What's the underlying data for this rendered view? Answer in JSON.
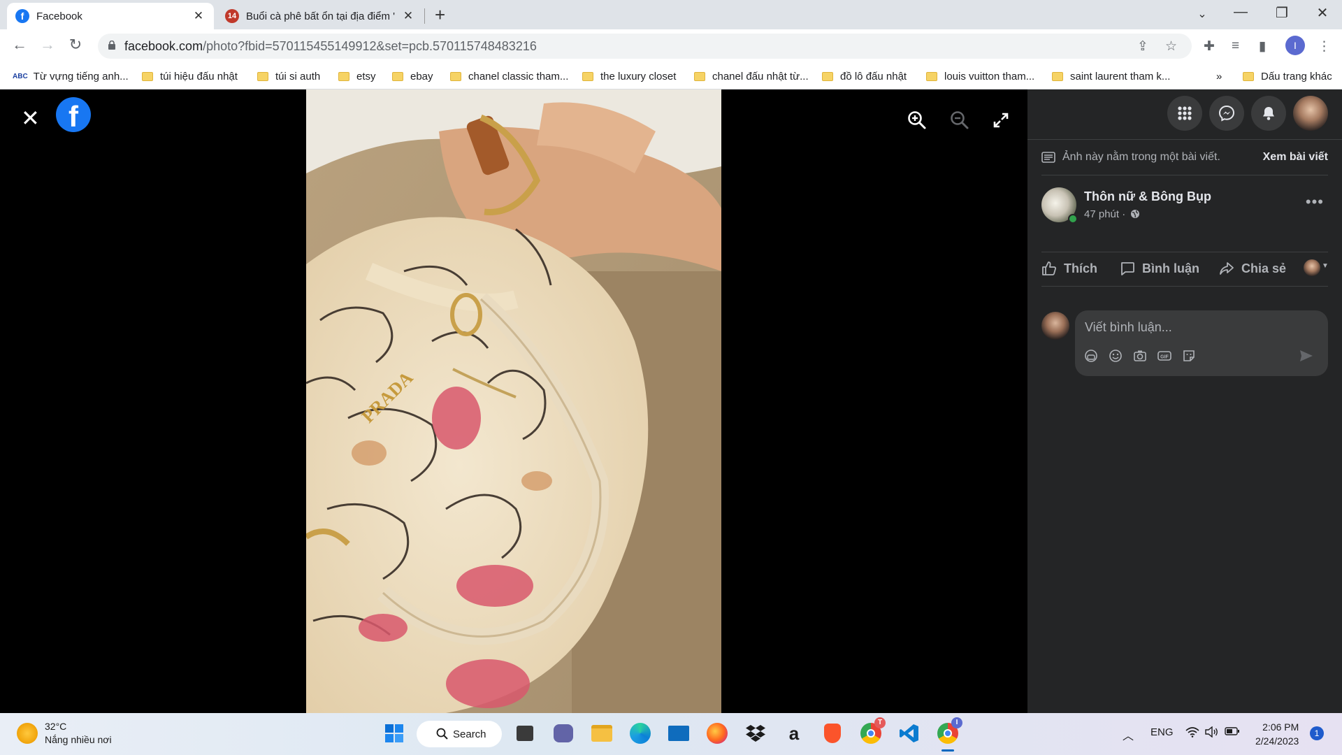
{
  "browser": {
    "tabs": [
      {
        "title": "Facebook",
        "active": true
      },
      {
        "title": "Buổi cà phê bất ổn tại địa điểm '",
        "active": false
      }
    ],
    "url_host": "facebook.com",
    "url_path": "/photo?fbid=570115455149912&set=pcb.570115748483216",
    "profile_initial": "I",
    "bookmarks": [
      "Từ vựng tiếng anh...",
      "túi hiệu đấu nhật",
      "túi si auth",
      "etsy",
      "ebay",
      "chanel classic tham...",
      "the luxury closet",
      "chanel đấu nhật từ...",
      "đồ lô đấu nhật",
      "louis vuitton tham...",
      "saint laurent tham k...",
      "»",
      "Dấu trang khác"
    ]
  },
  "viewer": {
    "brand_letter": "f",
    "image_alt_text": "PRADA"
  },
  "sidebar": {
    "notice": "Ảnh này nằm trong một bài viết.",
    "view_post": "Xem bài viết",
    "author_name": "Thôn nữ & Bông Bụp",
    "post_time": "47 phút ·",
    "actions": {
      "like": "Thích",
      "comment": "Bình luận",
      "share": "Chia sẻ"
    },
    "comment_placeholder": "Viết bình luận..."
  },
  "taskbar": {
    "temperature": "32°C",
    "weather_desc": "Nắng nhiều nơi",
    "search_label": "Search",
    "language": "ENG",
    "time": "2:06 PM",
    "date": "2/24/2023",
    "notification_count": "1",
    "chrome_badge_1": "T",
    "chrome_badge_2": "I"
  },
  "colors": {
    "facebook_blue": "#1877f2",
    "panel_bg": "#242526",
    "panel_input": "#3a3b3c"
  }
}
